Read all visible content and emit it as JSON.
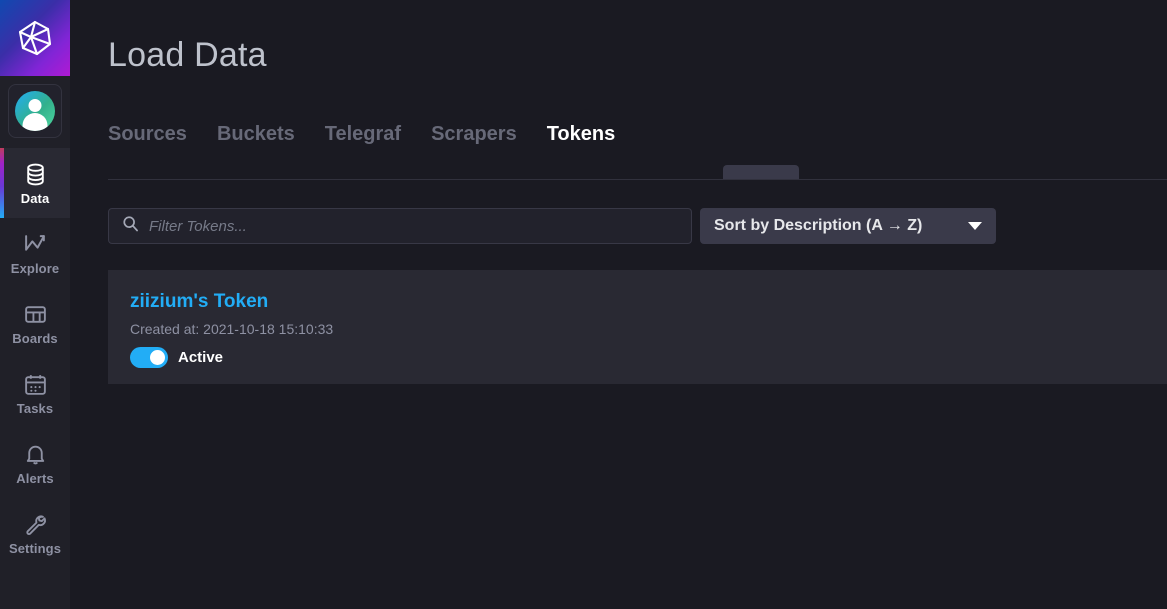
{
  "app": {
    "logo_icon": "influxdb-polyhedron-logo",
    "avatar_icon": "user-avatar"
  },
  "sidebar": {
    "items": [
      {
        "label": "Data",
        "icon": "database-icon",
        "active": true
      },
      {
        "label": "Explore",
        "icon": "graph-line-icon",
        "active": false
      },
      {
        "label": "Boards",
        "icon": "dashboard-grid-icon",
        "active": false
      },
      {
        "label": "Tasks",
        "icon": "calendar-icon",
        "active": false
      },
      {
        "label": "Alerts",
        "icon": "bell-icon",
        "active": false
      },
      {
        "label": "Settings",
        "icon": "wrench-icon",
        "active": false
      }
    ]
  },
  "header": {
    "title": "Load Data"
  },
  "tabs": [
    {
      "label": "Sources",
      "active": false
    },
    {
      "label": "Buckets",
      "active": false
    },
    {
      "label": "Telegraf",
      "active": false
    },
    {
      "label": "Scrapers",
      "active": false
    },
    {
      "label": "Tokens",
      "active": true
    }
  ],
  "filter": {
    "search_placeholder": "Filter Tokens...",
    "search_value": "",
    "search_icon": "search-icon",
    "sort_label": "Sort by Description (A → Z)",
    "sort_caret_icon": "chevron-down-icon"
  },
  "tokens": [
    {
      "name": "ziizium's Token",
      "created": "Created at: 2021-10-18 15:10:33",
      "status_label": "Active",
      "status_on": true
    }
  ],
  "colors": {
    "page_bg": "#1a1a22",
    "sidebar_bg": "#202028",
    "card_bg": "#292933",
    "accent_blue": "#22adf6",
    "muted_text": "#8e91a3",
    "tab_inactive": "#676978",
    "dropdown_bg": "#3a3a4a"
  }
}
